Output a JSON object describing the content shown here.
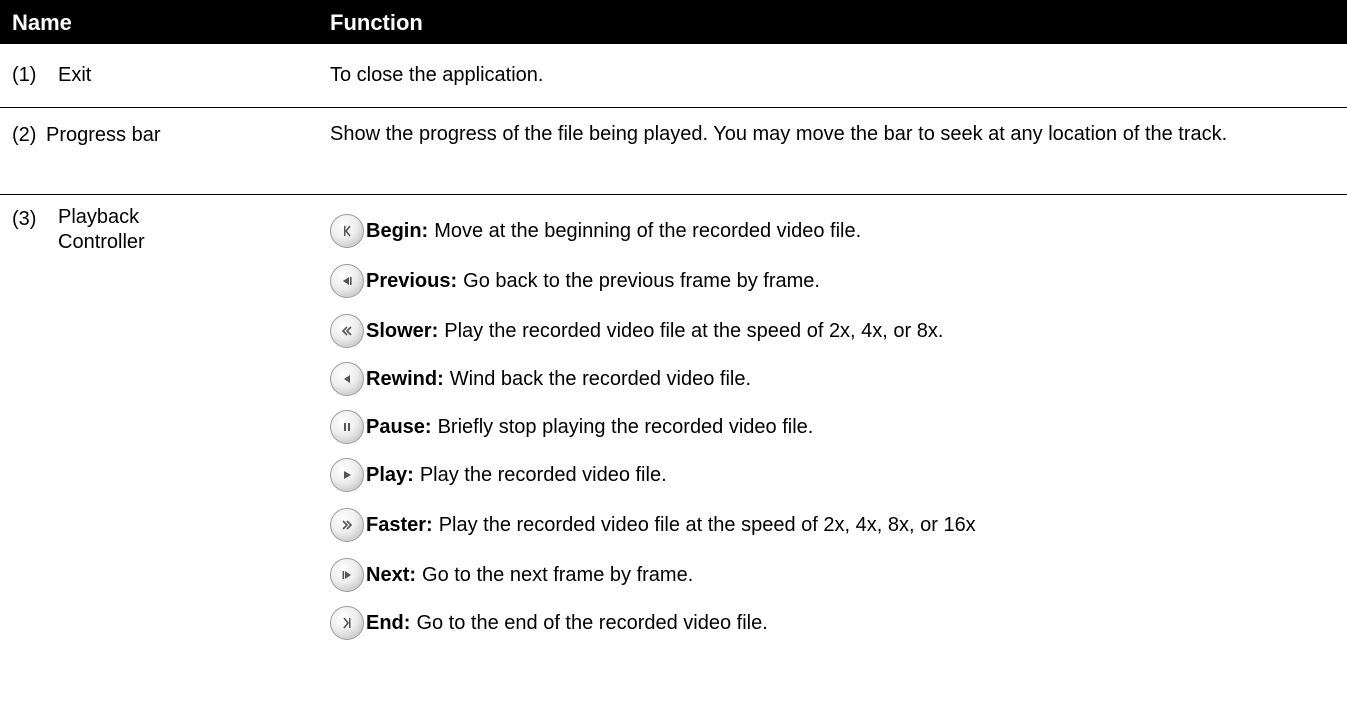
{
  "header": {
    "name_label": "Name",
    "function_label": "Function"
  },
  "rows": [
    {
      "number": "(1)",
      "name": "Exit",
      "function": "To close the application."
    },
    {
      "number": "(2)",
      "name": "Progress bar",
      "function": "Show the progress of the file being played. You may move the bar to seek at any location of the track."
    },
    {
      "number": "(3)",
      "name_line1": "Playback",
      "name_line2": "Controller",
      "controls": [
        {
          "icon": "begin-icon",
          "term": "Begin:",
          "desc": "Move at the beginning of the recorded video file."
        },
        {
          "icon": "previous-icon",
          "term": "Previous:",
          "desc": "Go back to the previous frame by frame."
        },
        {
          "icon": "slower-icon",
          "term": "Slower:",
          "desc": "Play the recorded video file at the speed of 2x, 4x, or 8x."
        },
        {
          "icon": "rewind-icon",
          "term": "Rewind:",
          "desc": "Wind back the recorded video file."
        },
        {
          "icon": "pause-icon",
          "term": "Pause:",
          "desc": "Briefly stop playing the recorded video file."
        },
        {
          "icon": "play-icon",
          "term": "Play:",
          "desc": "Play the recorded video file."
        },
        {
          "icon": "faster-icon",
          "term": "Faster:",
          "desc": "Play the recorded video file at the speed of 2x, 4x, 8x, or 16x"
        },
        {
          "icon": "next-icon",
          "term": "Next:",
          "desc": "Go to the next frame by frame."
        },
        {
          "icon": "end-icon",
          "term": "End:",
          "desc": "Go to the end of the recorded video file."
        }
      ]
    }
  ]
}
